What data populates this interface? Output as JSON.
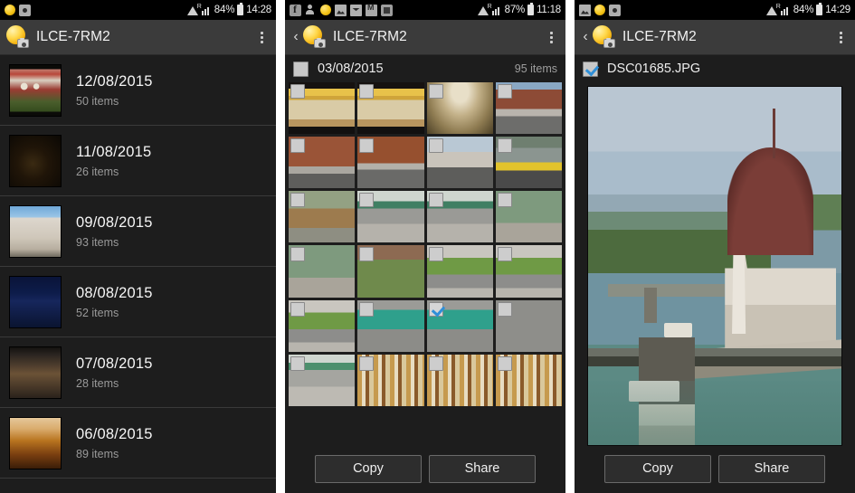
{
  "app": {
    "title": "ILCE-7RM2",
    "icon": "camera-app-icon",
    "accent_checked": "#2f8fd8",
    "actionbar_bg": "#3b3b3b",
    "page_bg": "#1d1d1d"
  },
  "panels": [
    {
      "id": "date-list",
      "statusbar": {
        "notification_icons": [
          "sun-app-icon",
          "camera-upload-icon"
        ],
        "wifi": "wifi-icon",
        "signal": "signal-icon",
        "roaming": "R",
        "battery_pct": "84%",
        "battery": "battery-icon",
        "time": "14:28"
      },
      "actionbar": {
        "back": false,
        "title": "ILCE-7RM2",
        "overflow": "overflow-menu-icon"
      },
      "dates": [
        {
          "date": "12/08/2015",
          "count": "50 items",
          "thumb": "th-market"
        },
        {
          "date": "11/08/2015",
          "count": "26 items",
          "thumb": "th-dark"
        },
        {
          "date": "09/08/2015",
          "count": "93 items",
          "thumb": "th-castle"
        },
        {
          "date": "08/08/2015",
          "count": "52 items",
          "thumb": "th-night"
        },
        {
          "date": "07/08/2015",
          "count": "28 items",
          "thumb": "th-store"
        },
        {
          "date": "06/08/2015",
          "count": "89 items",
          "thumb": "th-food"
        }
      ]
    },
    {
      "id": "photo-grid",
      "statusbar": {
        "notification_icons": [
          "facebook-icon",
          "contacts-icon",
          "sun-app-icon",
          "photo-icon",
          "mail-icon",
          "gmail-icon",
          "app-icon"
        ],
        "wifi": "wifi-icon",
        "signal": "signal-icon",
        "roaming": "R",
        "battery_pct": "87%",
        "battery": "battery-icon",
        "time": "11:18"
      },
      "actionbar": {
        "back": true,
        "title": "ILCE-7RM2",
        "overflow": "overflow-menu-icon"
      },
      "header": {
        "checked": false,
        "date": "03/08/2015",
        "count": "95 items"
      },
      "cells": [
        {
          "thumb": "ph-keys",
          "checked": false
        },
        {
          "thumb": "ph-keys",
          "checked": false
        },
        {
          "thumb": "ph-dome",
          "checked": false
        },
        {
          "thumb": "ph-street",
          "checked": false
        },
        {
          "thumb": "ph-brick",
          "checked": false
        },
        {
          "thumb": "ph-brick2",
          "checked": false
        },
        {
          "thumb": "ph-city",
          "checked": false
        },
        {
          "thumb": "ph-yellow",
          "checked": false
        },
        {
          "thumb": "ph-cart",
          "checked": false
        },
        {
          "thumb": "ph-bike",
          "checked": false
        },
        {
          "thumb": "ph-bike",
          "checked": false
        },
        {
          "thumb": "ph-hydrant",
          "checked": false
        },
        {
          "thumb": "ph-hydrant",
          "checked": false
        },
        {
          "thumb": "ph-grass",
          "checked": false
        },
        {
          "thumb": "ph-planter",
          "checked": false
        },
        {
          "thumb": "ph-planter",
          "checked": false
        },
        {
          "thumb": "ph-planter",
          "checked": false
        },
        {
          "thumb": "ph-teal",
          "checked": false
        },
        {
          "thumb": "ph-teal",
          "checked": true
        },
        {
          "thumb": "ph-wheel",
          "checked": false
        },
        {
          "thumb": "ph-bikefull",
          "checked": false
        },
        {
          "thumb": "ph-books",
          "checked": false
        },
        {
          "thumb": "ph-books",
          "checked": false
        },
        {
          "thumb": "ph-books",
          "checked": false
        }
      ],
      "buttons": {
        "copy": "Copy",
        "share": "Share"
      }
    },
    {
      "id": "photo-detail",
      "statusbar": {
        "notification_icons": [
          "photo-icon",
          "sun-app-icon",
          "camera-upload-icon"
        ],
        "wifi": "wifi-icon",
        "signal": "signal-icon",
        "roaming": "R",
        "battery_pct": "84%",
        "battery": "battery-icon",
        "time": "14:29"
      },
      "actionbar": {
        "back": true,
        "title": "ILCE-7RM2",
        "overflow": "overflow-menu-icon"
      },
      "file": {
        "checked": true,
        "name": "DSC01685.JPG"
      },
      "preview_alt": "budapest-parliament-danube-photo",
      "buttons": {
        "copy": "Copy",
        "share": "Share"
      }
    }
  ]
}
